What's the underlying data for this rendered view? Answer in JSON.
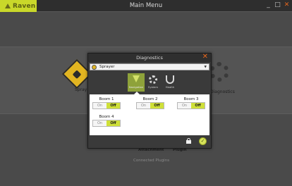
{
  "app": {
    "brand": "Raven",
    "window_title": "Main Menu"
  },
  "window_controls": {
    "minimize": "_",
    "maximize": "□",
    "close": "✕"
  },
  "background": {
    "spray_label": "Spray",
    "diagnostics_label": "Diagnostics",
    "attachment_label": "Attachment",
    "plugin_label": "Plugin",
    "footer": "Connected Plugins"
  },
  "dialog": {
    "title": "Diagnostics",
    "close": "✕",
    "device_select": {
      "value": "Sprayer",
      "icon": "sprayer-icon"
    },
    "tabs": [
      {
        "label": "Navigation",
        "icon": "check-icon",
        "active": true
      },
      {
        "label": "System",
        "icon": "gear-icon",
        "active": false
      },
      {
        "label": "Health",
        "icon": "stethoscope-icon",
        "active": false
      }
    ],
    "booms": [
      {
        "name": "Boom 1",
        "on": "On",
        "off": "Off",
        "state": "Off"
      },
      {
        "name": "Boom 2",
        "on": "On",
        "off": "Off",
        "state": "Off"
      },
      {
        "name": "Boom 3",
        "on": "On",
        "off": "Off",
        "state": "Off"
      },
      {
        "name": "Boom 4",
        "on": "On",
        "off": "Off",
        "state": "Off"
      }
    ],
    "ok_glyph": "✓"
  },
  "colors": {
    "accent": "#cfe038",
    "brand": "#c9d82a",
    "close": "#e8661c",
    "warning": "#e2b521"
  }
}
